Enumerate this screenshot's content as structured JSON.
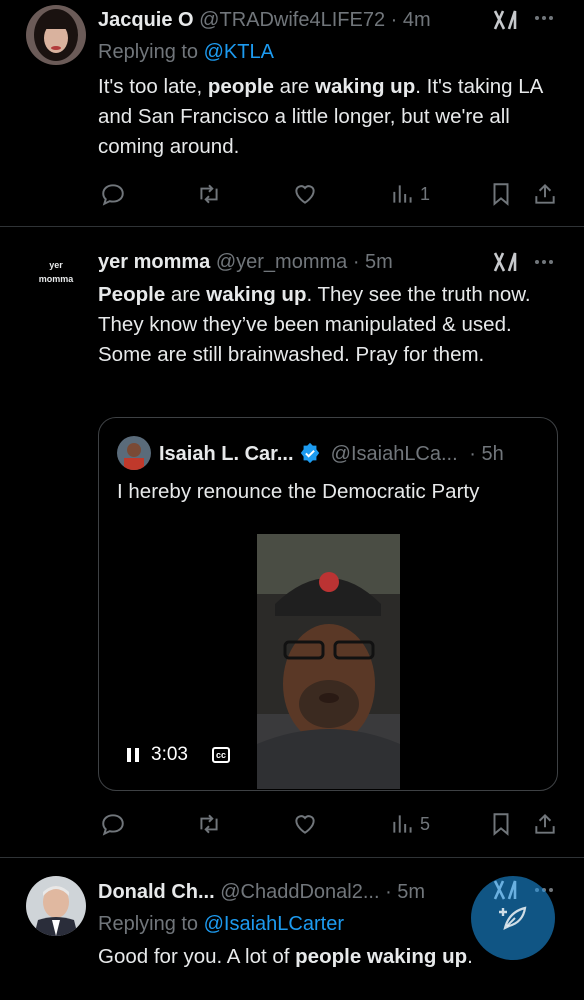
{
  "tweets": [
    {
      "name": "Jacquie O",
      "handle": "@TRADwife4LIFE72",
      "time": "· 4m",
      "replying_prefix": "Replying to ",
      "replying_to": "@KTLA",
      "text_parts": [
        "It's too late, ",
        "people",
        " are ",
        "waking up",
        ". It's taking LA and San Francisco a little longer, but we're all coming around."
      ],
      "views": "1"
    },
    {
      "avatar_text_1": "yer",
      "avatar_text_2": "momma",
      "name": "yer momma",
      "handle": "@yer_momma",
      "time": "· 5m",
      "text_parts": [
        "People",
        " are ",
        "waking up",
        ". They see the truth now. They know they’ve been manipulated & used.  Some are still brainwashed. Pray for them."
      ],
      "views": "5",
      "quote": {
        "name": "Isaiah L. Car...",
        "handle": "@IsaiahLCa...",
        "time": "· 5h",
        "text": "I hereby renounce the Democratic Party",
        "video_time": "3:03",
        "cc": "cc"
      }
    },
    {
      "name": "Donald Ch...",
      "handle": "@ChaddDonal2...",
      "time": "· 5m",
      "replying_prefix": "Replying to ",
      "replying_to": "@IsaiahLCarter",
      "text_parts": [
        "Good for you. A lot of ",
        "people waking up",
        "."
      ]
    }
  ],
  "icons": {
    "reply": "reply-icon",
    "retweet": "retweet-icon",
    "like": "heart-icon",
    "views": "views-icon",
    "bookmark": "bookmark-icon",
    "share": "share-icon",
    "grok": "grok-icon",
    "more": "more-icon",
    "verified": "verified-badge-icon",
    "compose": "compose-icon"
  },
  "colors": {
    "background": "#000000",
    "text": "#e7e9ea",
    "muted": "#71767b",
    "link": "#1d9bf0",
    "divider": "#2f3336"
  }
}
